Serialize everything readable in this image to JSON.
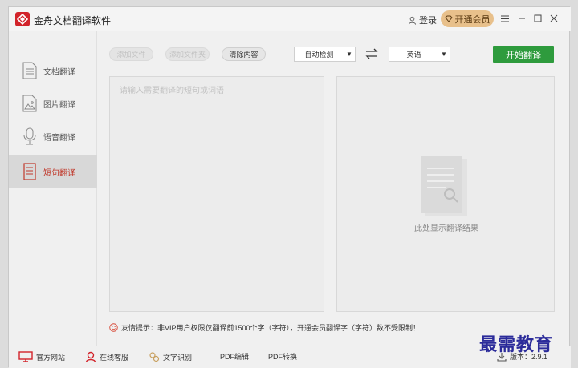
{
  "app": {
    "title": "金舟文档翻译软件"
  },
  "header": {
    "login_label": "登录",
    "vip_label": "开通会员"
  },
  "sidebar": {
    "items": [
      {
        "label": "文档翻译",
        "icon": "document-icon",
        "active": false
      },
      {
        "label": "图片翻译",
        "icon": "image-icon",
        "active": false
      },
      {
        "label": "语音翻译",
        "icon": "microphone-icon",
        "active": false
      },
      {
        "label": "短句翻译",
        "icon": "text-book-icon",
        "active": true
      }
    ]
  },
  "toolbar": {
    "add_file_label": "添加文件",
    "add_folder_label": "添加文件夹",
    "clear_label": "清除内容",
    "source_lang": "自动检测",
    "target_lang": "英语",
    "start_label": "开始翻译"
  },
  "input": {
    "placeholder": "请输入需要翻译的短句或词语"
  },
  "output": {
    "hint": "此处显示翻译结果"
  },
  "tip": {
    "text": "友情提示：非VIP用户权限仅翻译前1500个字（字符），开通会员翻译字（字符）数不受限制！"
  },
  "bottom": {
    "items": [
      {
        "label": "官方网站",
        "icon": "monitor-icon"
      },
      {
        "label": "在线客服",
        "icon": "support-icon"
      },
      {
        "label": "文字识别",
        "icon": "ocr-icon"
      },
      {
        "label": "PDF编辑",
        "icon": ""
      },
      {
        "label": "PDF转换",
        "icon": ""
      }
    ],
    "version": "版本：2.9.1"
  },
  "watermark": "最需教育",
  "colors": {
    "accent_green": "#2e9b3d",
    "brand_red": "#d2232a",
    "vip_gold": "#e8c08b",
    "active_red": "#c0392b"
  }
}
